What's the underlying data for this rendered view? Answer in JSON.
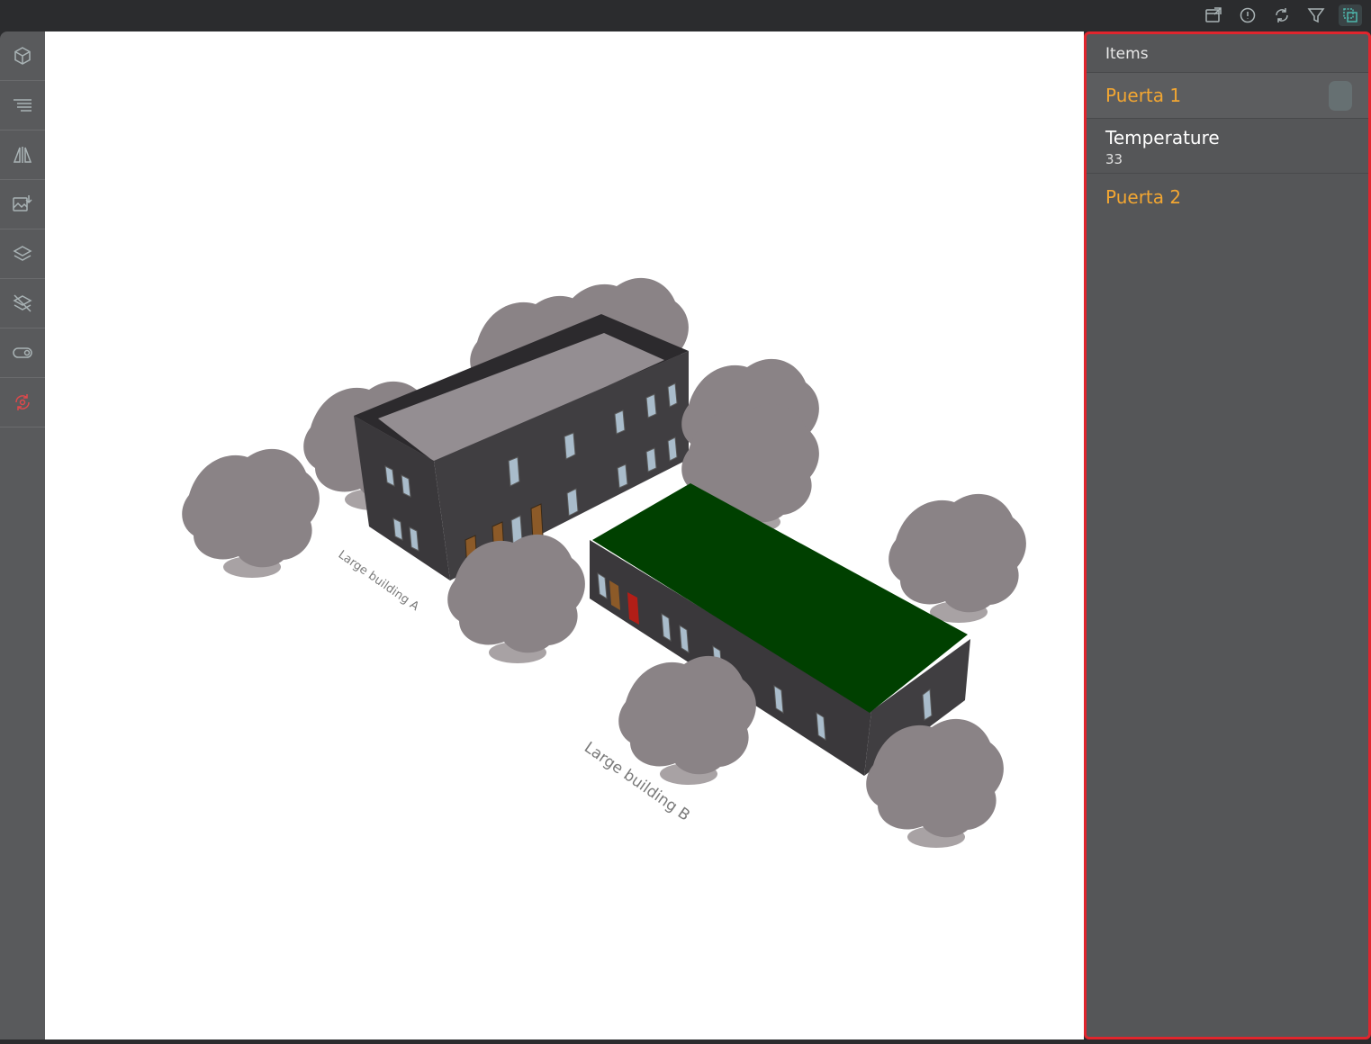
{
  "toolbar": {
    "icons": [
      "open-external-icon",
      "info-icon",
      "refresh-icon",
      "filter-icon",
      "selection-icon"
    ]
  },
  "sidebar": {
    "icons": [
      "cube-icon",
      "list-icon",
      "perspective-icon",
      "image-download-icon",
      "layers-icon",
      "hide-layers-icon",
      "toggle-icon",
      "reset-view-icon"
    ]
  },
  "scene": {
    "label_a": "Large building A",
    "label_b": "Large building B",
    "colors": {
      "roof_green": "#004000",
      "wall": "#3f3d40",
      "tree": "#8a8386",
      "door_red": "#b21e17",
      "door_wood": "#8c5a28"
    }
  },
  "panel": {
    "title": "Items",
    "items": [
      {
        "label": "Puerta 1"
      },
      {
        "name": "Temperature",
        "value": "33"
      },
      {
        "label": "Puerta 2"
      }
    ],
    "colors": {
      "accent": "#f2a632",
      "border": "#e0252d"
    }
  }
}
